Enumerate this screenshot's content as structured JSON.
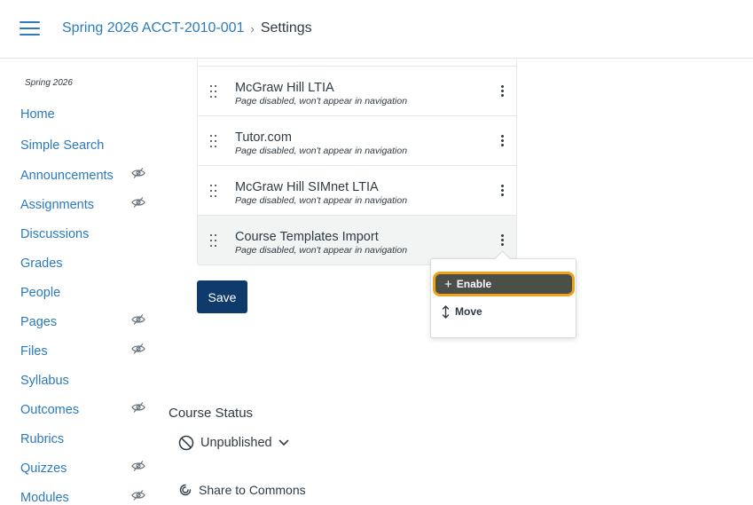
{
  "header": {
    "menu_icon": "hamburger-icon",
    "breadcrumb": {
      "course": "Spring 2026 ACCT-2010-001",
      "separator": "›",
      "current": "Settings"
    }
  },
  "sidebar": {
    "term": "Spring 2026",
    "items": [
      {
        "label": "Home",
        "hidden": false
      },
      {
        "label": "Simple Search",
        "hidden": false
      },
      {
        "label": "Announcements",
        "hidden": true
      },
      {
        "label": "Assignments",
        "hidden": true
      },
      {
        "label": "Discussions",
        "hidden": false
      },
      {
        "label": "Grades",
        "hidden": false
      },
      {
        "label": "People",
        "hidden": false
      },
      {
        "label": "Pages",
        "hidden": true
      },
      {
        "label": "Files",
        "hidden": true
      },
      {
        "label": "Syllabus",
        "hidden": false
      },
      {
        "label": "Outcomes",
        "hidden": true
      },
      {
        "label": "Rubrics",
        "hidden": false
      },
      {
        "label": "Quizzes",
        "hidden": true
      },
      {
        "label": "Modules",
        "hidden": true
      }
    ]
  },
  "nav_list": {
    "rows": [
      {
        "title": "McGraw Hill LTIA",
        "subtitle": "Page disabled, won't appear in navigation"
      },
      {
        "title": "Tutor.com",
        "subtitle": "Page disabled, won't appear in navigation"
      },
      {
        "title": "McGraw Hill SIMnet LTIA",
        "subtitle": "Page disabled, won't appear in navigation"
      },
      {
        "title": "Course Templates Import",
        "subtitle": "Page disabled, won't appear in navigation"
      }
    ]
  },
  "save_label": "Save",
  "menu": {
    "enable_icon": "+",
    "enable_label": "Enable",
    "move_label": "Move"
  },
  "course_status": {
    "heading": "Course Status",
    "status_label": "Unpublished",
    "share_label": "Share to Commons"
  },
  "colors": {
    "link": "#2b7abc",
    "primary_button": "#0e3b6b",
    "focus_ring": "#f1a21a",
    "menu_selected_bg": "#4a4f49"
  }
}
